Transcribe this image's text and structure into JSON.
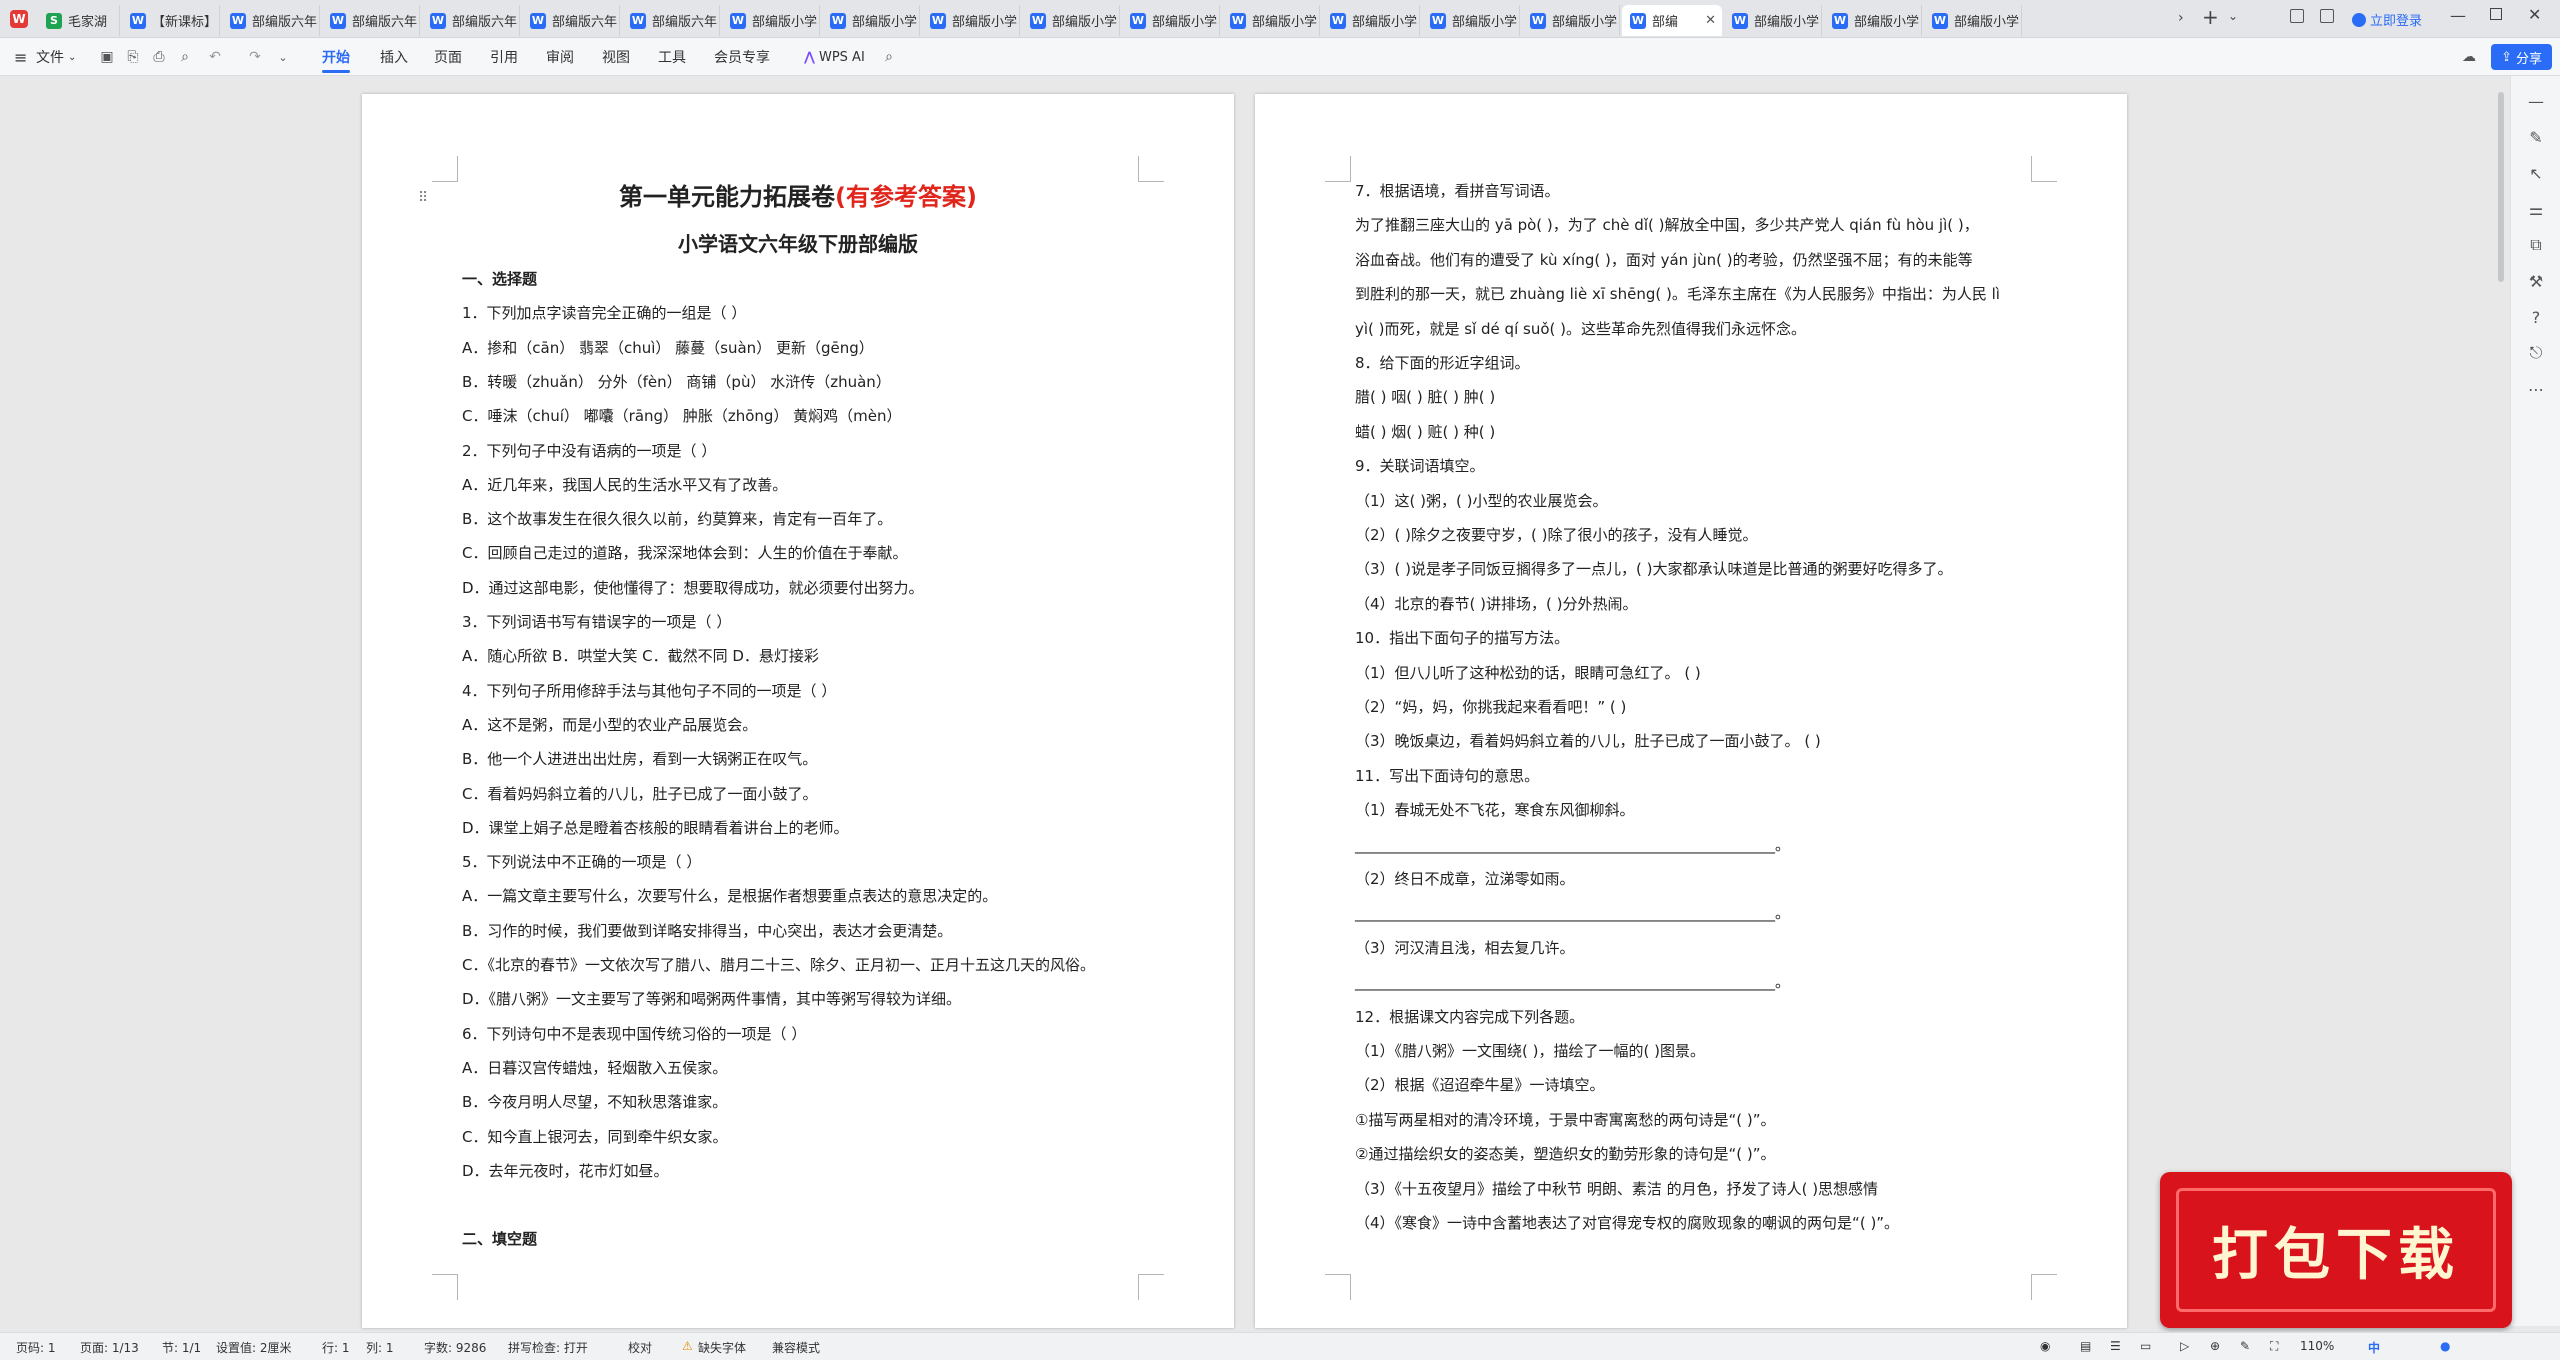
{
  "tabs": [
    {
      "label": "毛家湖",
      "type": "s"
    },
    {
      "label": "【新课标】",
      "type": "w"
    },
    {
      "label": "部编版六年",
      "type": "w"
    },
    {
      "label": "部编版六年",
      "type": "w"
    },
    {
      "label": "部编版六年",
      "type": "w"
    },
    {
      "label": "部编版六年",
      "type": "w"
    },
    {
      "label": "部编版六年",
      "type": "w"
    },
    {
      "label": "部编版小学",
      "type": "w"
    },
    {
      "label": "部编版小学",
      "type": "w"
    },
    {
      "label": "部编版小学",
      "type": "w"
    },
    {
      "label": "部编版小学",
      "type": "w"
    },
    {
      "label": "部编版小学",
      "type": "w"
    },
    {
      "label": "部编版小学",
      "type": "w"
    },
    {
      "label": "部编版小学",
      "type": "w"
    },
    {
      "label": "部编版小学",
      "type": "w"
    },
    {
      "label": "部编版小学",
      "type": "w"
    },
    {
      "label": "部编",
      "type": "w",
      "active": true
    },
    {
      "label": "部编版小学",
      "type": "w"
    },
    {
      "label": "部编版小学",
      "type": "w"
    },
    {
      "label": "部编版小学",
      "type": "w"
    }
  ],
  "titlebar": {
    "login": "立即登录"
  },
  "ribbon": {
    "file": "文件",
    "menus": [
      "开始",
      "插入",
      "页面",
      "引用",
      "审阅",
      "视图",
      "工具",
      "会员专享"
    ],
    "ai": "WPS AI",
    "share": "分享"
  },
  "page1": {
    "title_main": "第一单元能力拓展卷",
    "title_red": "(有参考答案)",
    "subtitle": "小学语文六年级下册部编版",
    "lines": [
      {
        "t": "一、选择题",
        "b": true
      },
      {
        "t": "1．下列加点字读音完全正确的一组是（    ）"
      },
      {
        "t": "A．掺和（cān）      翡翠（chuì）      藤蔓（suàn）      更新（gēng）"
      },
      {
        "t": "B．转暖（zhuǎn）    分外（fèn）       商铺（pù）        水浒传（zhuàn）"
      },
      {
        "t": "C．唾沫（chuí）     嘟囔（rāng）      肿胀（zhōng）     黄焖鸡（mèn）"
      },
      {
        "t": "2．下列句子中没有语病的一项是（    ）"
      },
      {
        "t": "A．近几年来，我国人民的生活水平又有了改善。"
      },
      {
        "t": "B．这个故事发生在很久很久以前，约莫算来，肯定有一百年了。"
      },
      {
        "t": "C．回顾自己走过的道路，我深深地体会到：人生的价值在于奉献。"
      },
      {
        "t": "D．通过这部电影，使他懂得了：想要取得成功，就必须要付出努力。"
      },
      {
        "t": "3．下列词语书写有错误字的一项是（    ）"
      },
      {
        "t": "A．随心所欲            B．哄堂大笑            C．截然不同            D．悬灯接彩"
      },
      {
        "t": "4．下列句子所用修辞手法与其他句子不同的一项是（    ）"
      },
      {
        "t": "A．这不是粥，而是小型的农业产品展览会。"
      },
      {
        "t": "B．他一个人进进出出灶房，看到一大锅粥正在叹气。"
      },
      {
        "t": "C．看着妈妈斜立着的八儿，肚子已成了一面小鼓了。"
      },
      {
        "t": "D．课堂上娟子总是瞪着杏核般的眼睛看着讲台上的老师。"
      },
      {
        "t": "5．下列说法中不正确的一项是（    ）"
      },
      {
        "t": "A．一篇文章主要写什么，次要写什么，是根据作者想要重点表达的意思决定的。"
      },
      {
        "t": "B．习作的时候，我们要做到详略安排得当，中心突出，表达才会更清楚。"
      },
      {
        "t": "C．《北京的春节》一文依次写了腊八、腊月二十三、除夕、正月初一、正月十五这几天的风俗。"
      },
      {
        "t": "D．《腊八粥》一文主要写了等粥和喝粥两件事情，其中等粥写得较为详细。"
      },
      {
        "t": "6．下列诗句中不是表现中国传统习俗的一项是（    ）"
      },
      {
        "t": "A．日暮汉宫传蜡烛，轻烟散入五侯家。"
      },
      {
        "t": "B．今夜月明人尽望，不知秋思落谁家。"
      },
      {
        "t": "C．知今直上银河去，同到牵牛织女家。"
      },
      {
        "t": "D．去年元夜时，花市灯如昼。"
      },
      {
        "t": ""
      },
      {
        "t": "二、填空题",
        "b": true
      }
    ]
  },
  "page2": {
    "lines": [
      "7．根据语境，看拼音写词语。",
      "为了推翻三座大山的 yā pò(        )，为了 chè dǐ(        )解放全中国，多少共产党人 qián fù hòu jì(        )，",
      "浴血奋战。他们有的遭受了 kù xíng(        )，面对 yán jùn(        )的考验，仍然坚强不屈；有的未能等",
      "到胜利的那一天，就已 zhuàng liè xī shēng(        )。毛泽东主席在《为人民服务》中指出：为人民 lì",
      "yì(        )而死，就是 sǐ dé qí suǒ(        )。这些革命先烈值得我们永远怀念。",
      "8．给下面的形近字组词。",
      "腊(    )   咽(    )   脏(    )   肿(    )",
      "蜡(    )   烟(    )   赃(    )   种(    )",
      "9．关联词语填空。",
      "（1）这(          )粥，(          )小型的农业展览会。",
      "（2）(          )除夕之夜要守岁，(          )除了很小的孩子，没有人睡觉。",
      "（3）(          )说是孝子同饭豆搁得多了一点儿，(          )大家都承认味道是比普通的粥要好吃得多了。",
      "（4）北京的春节(          )讲排场，(          )分外热闹。",
      "10．指出下面句子的描写方法。",
      "（1）但八儿听了这种松劲的话，眼睛可急红了。  (          )",
      "（2）“妈，妈，你挑我起来看看吧！”  (          )",
      "（3）晚饭桌边，看着妈妈斜立着的八儿，肚子已成了一面小鼓了。  (          )",
      "11．写出下面诗句的意思。",
      "（1）春城无处不飞花，寒食东风御柳斜。",
      "________________________________________________________。",
      "（2）终日不成章，泣涕零如雨。",
      "________________________________________________________。",
      "（3）河汉清且浅，相去复几许。",
      "________________________________________________________。",
      "12．根据课文内容完成下列各题。",
      "（1）《腊八粥》一文围绕(                    )，描绘了一幅的(                              )图景。",
      "（2）根据《迢迢牵牛星》一诗填空。",
      "①描写两星相对的清冷环境，于景中寄寓离愁的两句诗是“(                              )”。",
      "②通过描绘织女的姿态美，塑造织女的勤劳形象的诗句是“(                              )”。",
      "（3）《十五夜望月》描绘了中秋节 明朗、素洁 的月色，抒发了诗人(                    )思想感情",
      "（4）《寒食》一诗中含蓄地表达了对官得宠专权的腐败现象的嘲讽的两句是“(                    )”。"
    ]
  },
  "statusbar": {
    "page": "页码: 1",
    "pages": "页面: 1/13",
    "section": "节: 1/1",
    "setting": "设置值: 2厘米",
    "row": "行: 1",
    "col": "列: 1",
    "words": "字数: 9286",
    "spell": "拼写检查: 打开",
    "proof": "校对",
    "font": "缺失字体",
    "compat": "兼容模式",
    "zoom": "110%",
    "ime": "中"
  },
  "promo": {
    "text": "打包下载"
  },
  "colors": {
    "accent": "#2b6cf6",
    "red": "#e1251b",
    "promo_bg": "#d8131b"
  }
}
